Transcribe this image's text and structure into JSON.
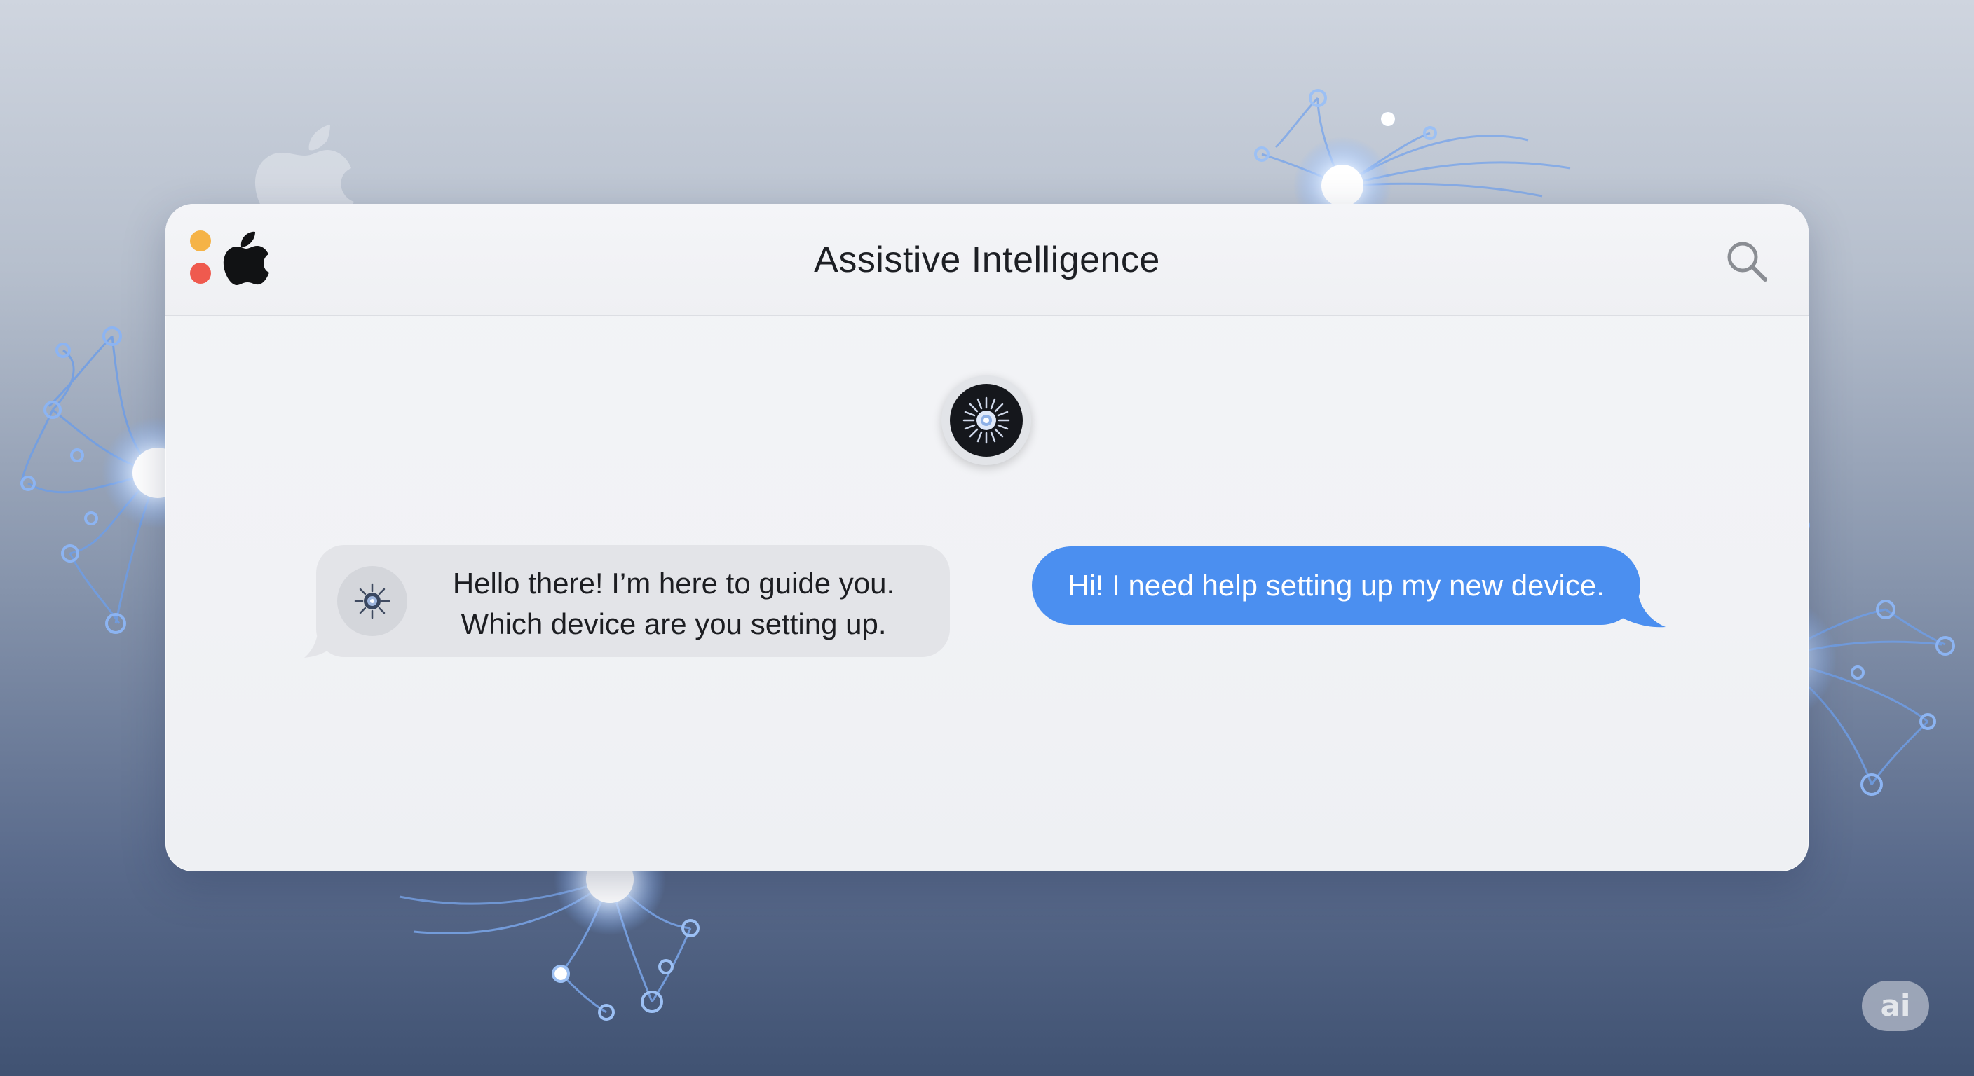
{
  "window": {
    "title": "Assistive Intelligence"
  },
  "icons": {
    "brand": "apple-logo-icon",
    "search": "search-icon",
    "assistant": "assistant-spark-icon"
  },
  "conversation": {
    "messages": [
      {
        "sender": "assistant",
        "lines": [
          "Hello there! I’m here to guide you.",
          "Which device are you setting up."
        ]
      },
      {
        "sender": "user",
        "text": "Hi! I need help setting up my new device."
      }
    ]
  },
  "badge": {
    "label": "ai"
  },
  "colors": {
    "user_bubble": "#4b8ff0",
    "assistant_bubble": "#e3e4e8",
    "traffic_orange": "#f5b347",
    "traffic_red": "#ef5a4e"
  }
}
